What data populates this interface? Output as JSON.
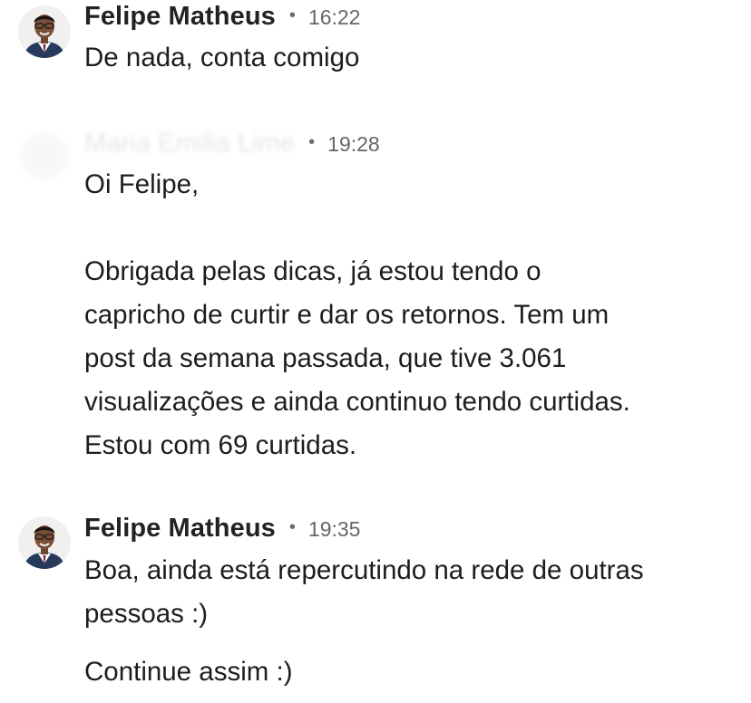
{
  "messages": [
    {
      "sender": "Felipe Matheus",
      "time": "16:22",
      "lines": [
        "De nada, conta comigo"
      ]
    },
    {
      "sender": "Maria Emilia Lime",
      "time": "19:28",
      "greeting": "Oi Felipe,",
      "lines": [
        "Obrigada pelas dicas, já estou tendo o",
        "capricho de curtir e dar os retornos. Tem um",
        "post da semana passada, que tive 3.061",
        "visualizações e ainda continuo tendo curtidas.",
        "Estou com  69 curtidas."
      ]
    },
    {
      "sender": "Felipe Matheus",
      "time": "19:35",
      "lines": [
        "Boa, ainda está repercutindo na rede de outras",
        "pessoas :)"
      ],
      "followup": "Continue assim :)"
    }
  ],
  "separator": "•",
  "colors": {
    "text": "#1d1d1d",
    "timestamp": "#666666",
    "background": "#ffffff"
  }
}
